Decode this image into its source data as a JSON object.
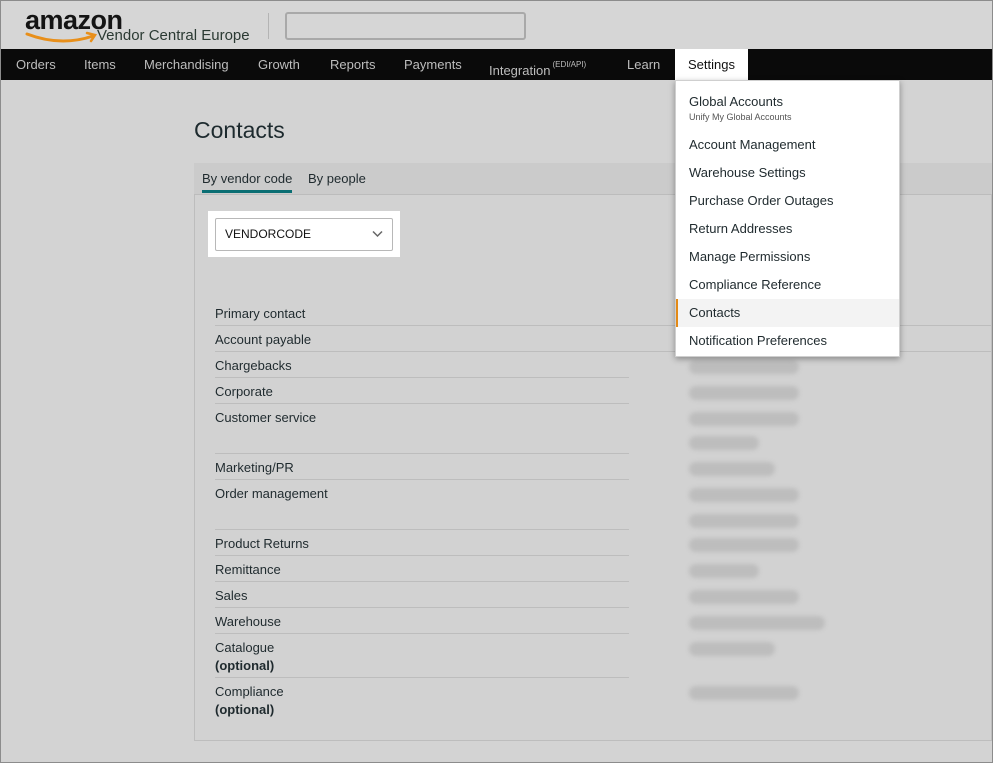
{
  "brand": {
    "logo_text": "amazon",
    "logo_sub": "Vendor Central Europe",
    "logo_color": "#e88f1a"
  },
  "header": {
    "search_placeholder": ""
  },
  "nav": {
    "items": [
      {
        "label": "Orders"
      },
      {
        "label": "Items"
      },
      {
        "label": "Merchandising"
      },
      {
        "label": "Growth"
      },
      {
        "label": "Reports"
      },
      {
        "label": "Payments"
      },
      {
        "label": "Integration",
        "sup": "(EDI/API)"
      },
      {
        "label": "Learn"
      },
      {
        "label": "Settings"
      }
    ]
  },
  "page": {
    "title": "Contacts",
    "tabs": [
      {
        "label": "By vendor code"
      },
      {
        "label": "By people"
      }
    ],
    "vendor_select": {
      "value": "VENDORCODE"
    },
    "contacts": [
      {
        "label": "Primary contact"
      },
      {
        "label": "Account payable"
      },
      {
        "label": "Chargebacks"
      },
      {
        "label": "Corporate"
      },
      {
        "label": "Customer service"
      },
      {
        "label": "Marketing/PR"
      },
      {
        "label": "Order management"
      },
      {
        "label": "Product Returns"
      },
      {
        "label": "Remittance"
      },
      {
        "label": "Sales"
      },
      {
        "label": "Warehouse"
      },
      {
        "label": "Catalogue",
        "note": "(optional)"
      },
      {
        "label": "Compliance",
        "note": "(optional)"
      }
    ]
  },
  "settings_menu": {
    "items": [
      {
        "label": "Global Accounts",
        "sub": "Unify My Global Accounts"
      },
      {
        "label": "Account Management"
      },
      {
        "label": "Warehouse Settings"
      },
      {
        "label": "Purchase Order Outages"
      },
      {
        "label": "Return Addresses"
      },
      {
        "label": "Manage Permissions"
      },
      {
        "label": "Compliance Reference"
      },
      {
        "label": "Contacts"
      },
      {
        "label": "Notification Preferences"
      }
    ],
    "accent_color": "#e38a17"
  }
}
